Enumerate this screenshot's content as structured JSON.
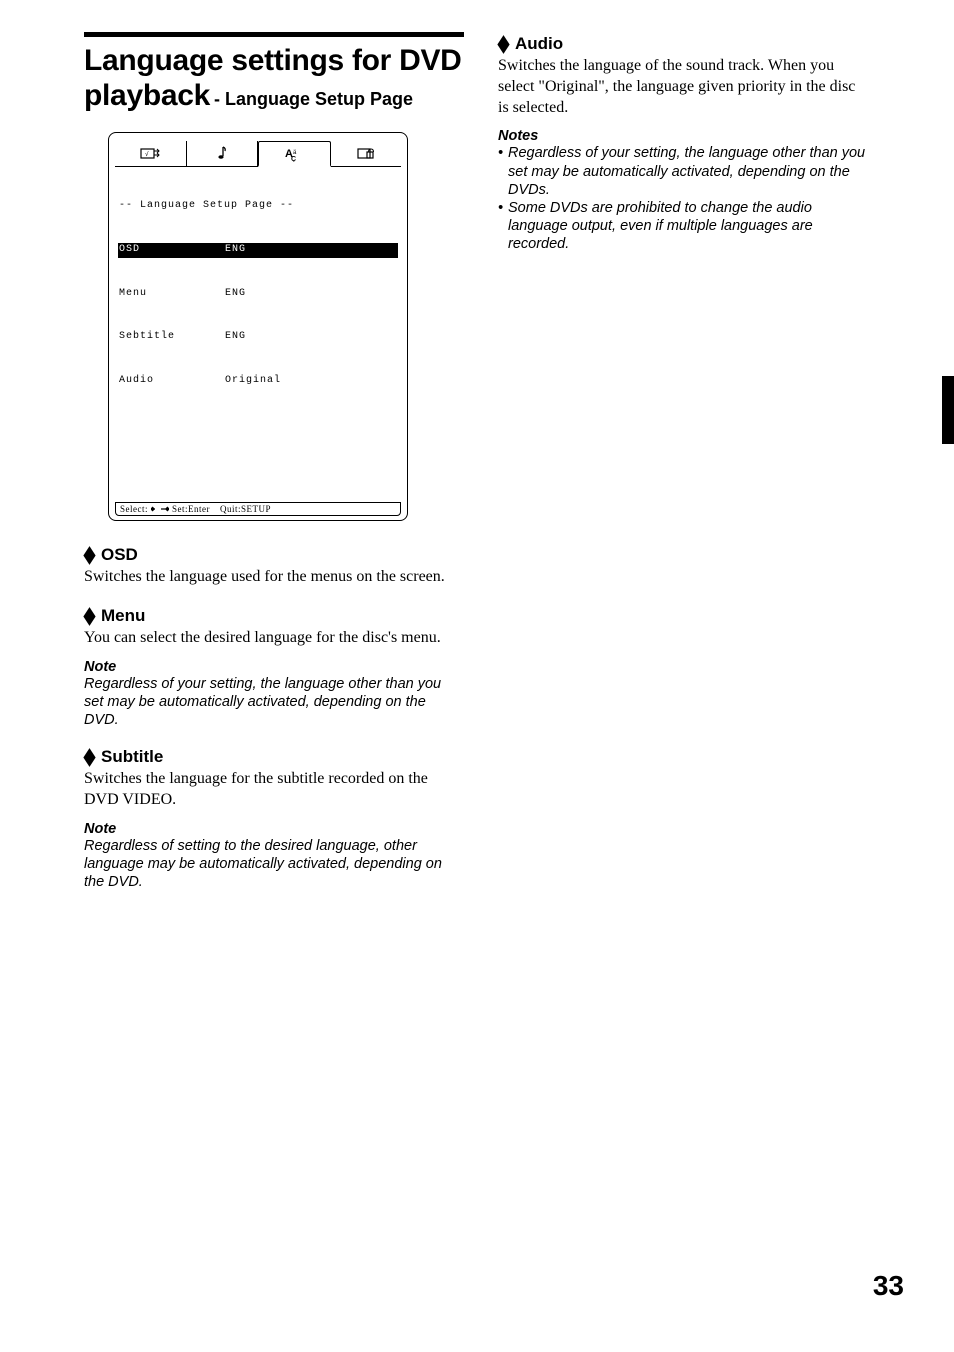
{
  "title": {
    "main": "Language settings for DVD playback",
    "sub": " - Language Setup Page"
  },
  "osd_screenshot": {
    "title": "-- Language Setup Page --",
    "rows": [
      {
        "label": "OSD",
        "value": "ENG",
        "highlighted": true
      },
      {
        "label": "Menu",
        "value": "ENG",
        "highlighted": false
      },
      {
        "label": "Sebtitle",
        "value": "ENG",
        "highlighted": false
      },
      {
        "label": "Audio",
        "value": "Original",
        "highlighted": false
      }
    ],
    "footer": {
      "select": "Select:",
      "set": "Set:Enter",
      "quit": "Quit:SETUP"
    },
    "tab_icons": [
      "video-out-icon",
      "music-note-icon",
      "language-icon",
      "lock-icon"
    ],
    "selected_tab": 2
  },
  "left_sections": [
    {
      "heading": "OSD",
      "body": "Switches the language used for the menus on the screen."
    },
    {
      "heading": "Menu",
      "body": "You can select the desired language for the disc's menu.",
      "note_h": "Note",
      "note": "Regardless of your setting, the language other than you set may be automatically activated, depending on the DVD."
    },
    {
      "heading": "Subtitle",
      "body": "Switches the language for the subtitle recorded on the DVD VIDEO.",
      "note_h": "Note",
      "note": "Regardless of setting to the desired language, other language may be automatically activated, depending on the DVD."
    }
  ],
  "right_sections": [
    {
      "heading": "Audio",
      "body": "Switches the language of the sound track. When you select \"Original\", the language given priority in the disc is selected.",
      "notes_h": "Notes",
      "notes": [
        "Regardless of your setting, the language other than you set may be automatically activated, depending on the DVDs.",
        "Some DVDs are prohibited to change the audio language output, even if multiple languages are recorded."
      ]
    }
  ],
  "page_number": "33"
}
